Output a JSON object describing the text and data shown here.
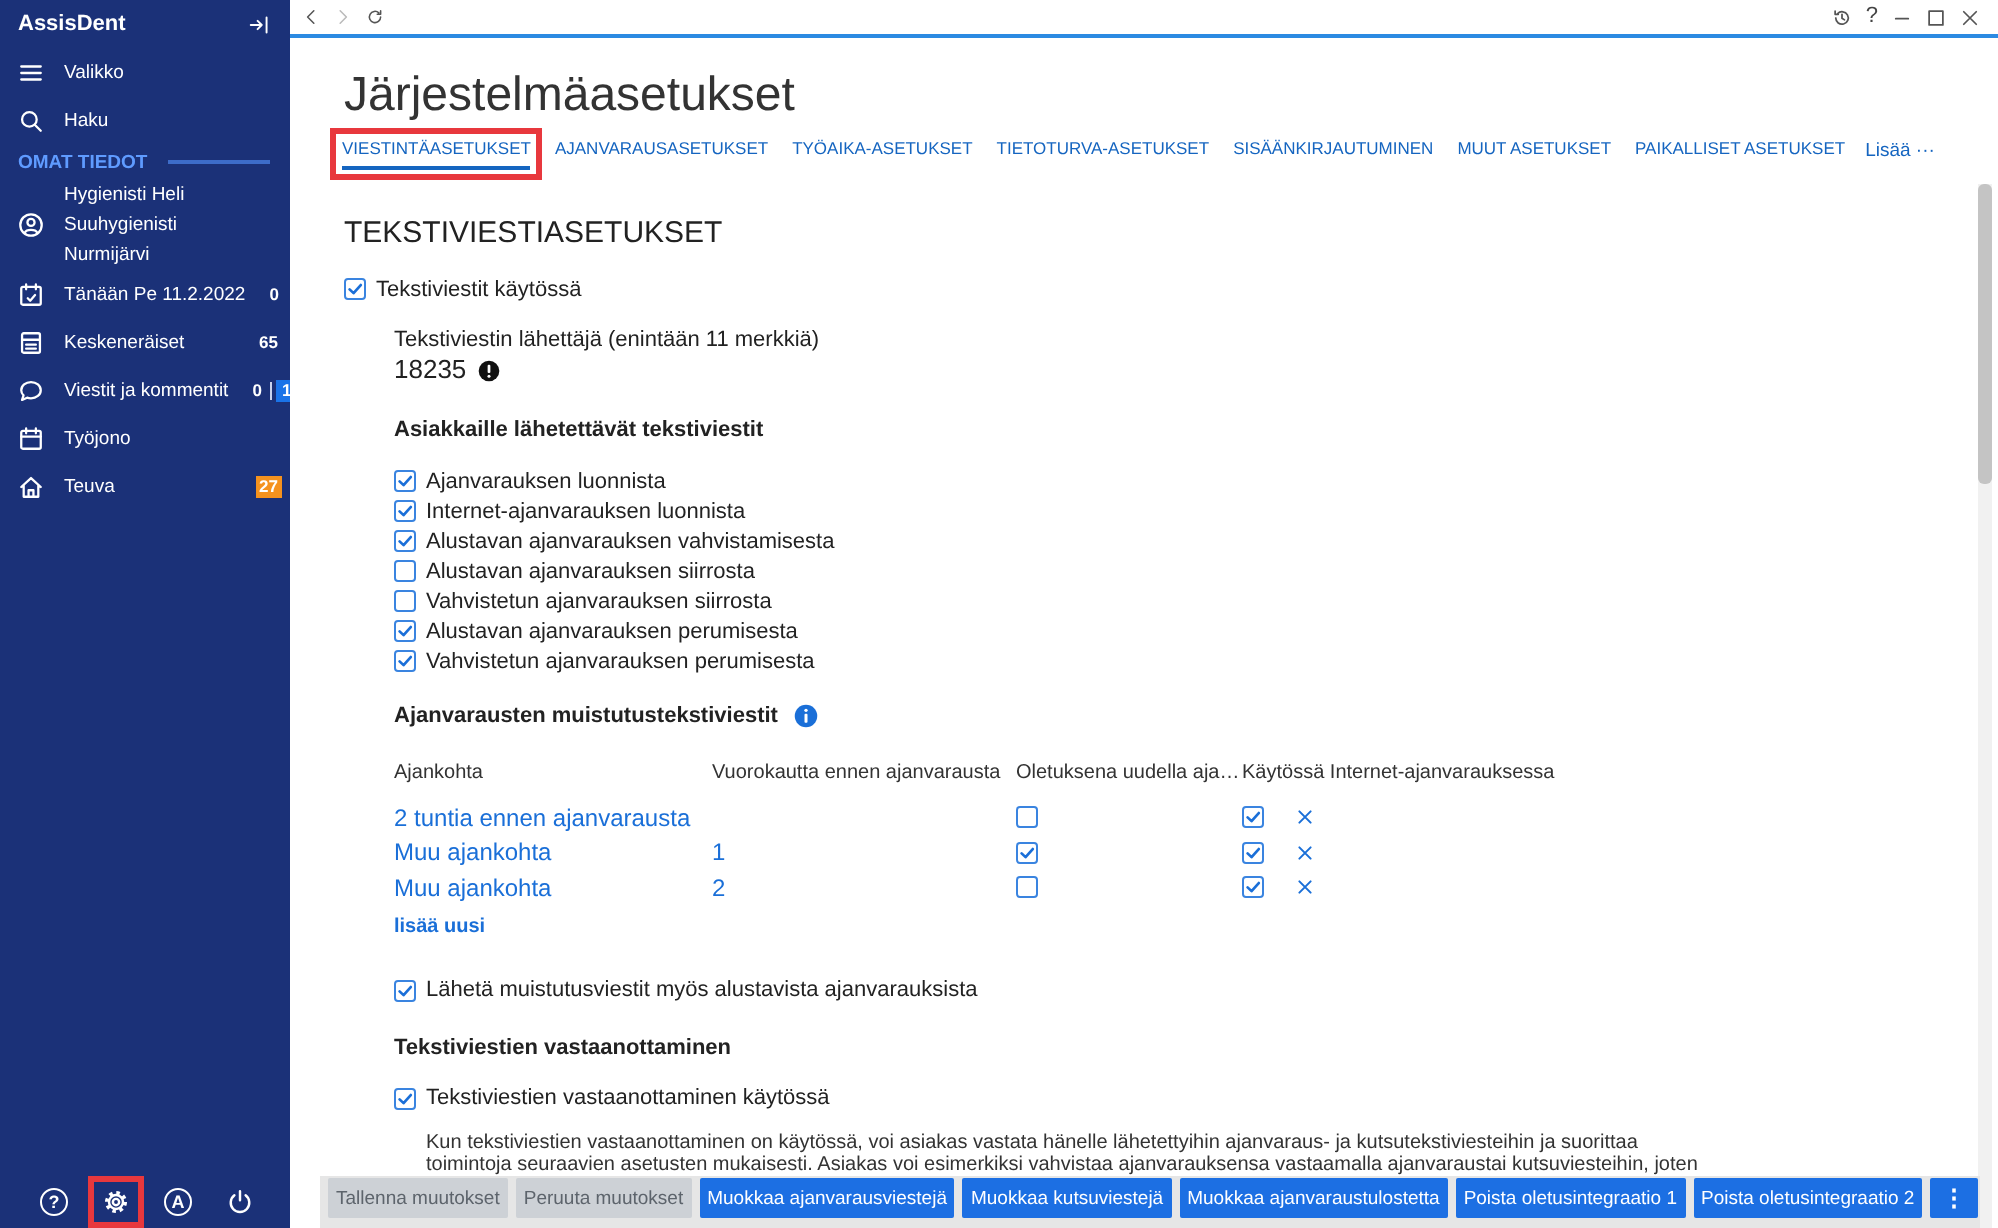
{
  "sidebar": {
    "app_name": "AssisDent",
    "menu": [
      {
        "label": "Valikko"
      },
      {
        "label": "Haku"
      }
    ],
    "section_title": "OMAT TIEDOT",
    "user": {
      "lines": [
        "Hygienisti Heli",
        "Suuhygienisti",
        "Nurmijärvi"
      ]
    },
    "items": [
      {
        "label": "Tänään Pe 11.2.2022",
        "badges": [
          {
            "kind": "plain",
            "text": "0"
          }
        ]
      },
      {
        "label": "Keskeneräiset",
        "badges": [
          {
            "kind": "plain",
            "text": "65"
          }
        ]
      },
      {
        "label": "Viestit ja kommentit",
        "badges": [
          {
            "kind": "plain",
            "text": "0"
          },
          {
            "kind": "new",
            "text": "1"
          }
        ]
      },
      {
        "label": "Työjono"
      },
      {
        "label": "Teuva",
        "badges": [
          {
            "kind": "alert",
            "text": "27"
          }
        ]
      }
    ],
    "footer_icons": [
      {
        "kind": "glyph",
        "text": "?",
        "highlighted": false
      },
      {
        "kind": "gear",
        "highlighted": true
      },
      {
        "kind": "glyph",
        "text": "A",
        "highlighted": false
      },
      {
        "kind": "power",
        "highlighted": false
      }
    ]
  },
  "toolbar": {
    "help": "?"
  },
  "page": {
    "title": "Järjestelmäasetukset",
    "tabs": [
      {
        "label": "VIESTINTÄASETUKSET",
        "selected": true,
        "highlighted": true
      },
      {
        "label": "AJANVARAUSASETUKSET",
        "selected": false,
        "highlighted": false
      },
      {
        "label": "TYÖAIKA-ASETUKSET",
        "selected": false,
        "highlighted": false
      },
      {
        "label": "TIETOTURVA-ASETUKSET",
        "selected": false,
        "highlighted": false
      },
      {
        "label": "SISÄÄNKIRJAUTUMINEN",
        "selected": false,
        "highlighted": false
      },
      {
        "label": "MUUT ASETUKSET",
        "selected": false,
        "highlighted": false
      },
      {
        "label": "PAIKALLISET ASETUKSET",
        "selected": false,
        "highlighted": false
      }
    ],
    "more_tabs": "Lisää ···"
  },
  "sms_settings": {
    "title": "TEKSTIVIESTIASETUKSET",
    "enabled": {
      "label": "Tekstiviestit käytössä",
      "checked": true
    },
    "sender": {
      "label": "Tekstiviestin lähettäjä (enintään 11 merkkiä)",
      "value": "18235"
    },
    "customer_messages": {
      "heading": "Asiakkaille lähetettävät tekstiviestit",
      "options": [
        {
          "label": "Ajanvarauksen luonnista",
          "checked": true
        },
        {
          "label": "Internet-ajanvarauksen luonnista",
          "checked": true
        },
        {
          "label": "Alustavan ajanvarauksen vahvistamisesta",
          "checked": true
        },
        {
          "label": "Alustavan ajanvarauksen siirrosta",
          "checked": false
        },
        {
          "label": "Vahvistetun ajanvarauksen siirrosta",
          "checked": false
        },
        {
          "label": "Alustavan ajanvarauksen perumisesta",
          "checked": true
        },
        {
          "label": "Vahvistetun ajanvarauksen perumisesta",
          "checked": true
        }
      ]
    },
    "reminders": {
      "heading": "Ajanvarausten muistutustekstiviestit",
      "columns": [
        "Ajankohta",
        "Vuorokautta ennen ajanvarausta",
        "Oletuksena uudella aja…",
        "Käytössä Internet-ajanvarauksessa"
      ],
      "rows": [
        {
          "time": "2 tuntia ennen ajanvarausta",
          "default": false,
          "internet": true
        },
        {
          "time": "Muu ajankohta",
          "days": "1",
          "default": true,
          "internet": true
        },
        {
          "time": "Muu ajankohta",
          "days": "2",
          "default": false,
          "internet": true
        }
      ],
      "add_link": "lisää uusi",
      "preliminary": {
        "label": "Lähetä muistutusviestit myös alustavista ajanvarauksista",
        "checked": true
      }
    },
    "receiving": {
      "heading": "Tekstiviestien vastaanottaminen",
      "enabled": {
        "label": "Tekstiviestien vastaanottaminen käytössä",
        "checked": true
      },
      "description_lines": [
        "Kun tekstiviestien vastaanottaminen on käytössä, voi asiakas vastata hänelle lähetettyihin ajanvaraus- ja kutsutekstiviesteihin ja suorittaa",
        "toimintoja seuraavien asetusten mukaisesti. Asiakas voi esimerkiksi vahvistaa ajanvarauksensa vastaamalla ajanvaraustai kutsuviesteihin, joten"
      ]
    }
  },
  "actions": {
    "buttons": [
      {
        "label": "Tallenna muutokset",
        "disabled": true
      },
      {
        "label": "Peruuta muutokset",
        "disabled": true
      },
      {
        "label": "Muokkaa ajanvarausviestejä",
        "disabled": false
      },
      {
        "label": "Muokkaa kutsuviestejä",
        "disabled": false
      },
      {
        "label": "Muokkaa ajanvaraustulostetta",
        "disabled": false
      },
      {
        "label": "Poista oletusintegraatio 1",
        "disabled": false
      },
      {
        "label": "Poista oletusintegraatio 2",
        "disabled": false
      }
    ],
    "more": "⋮"
  }
}
